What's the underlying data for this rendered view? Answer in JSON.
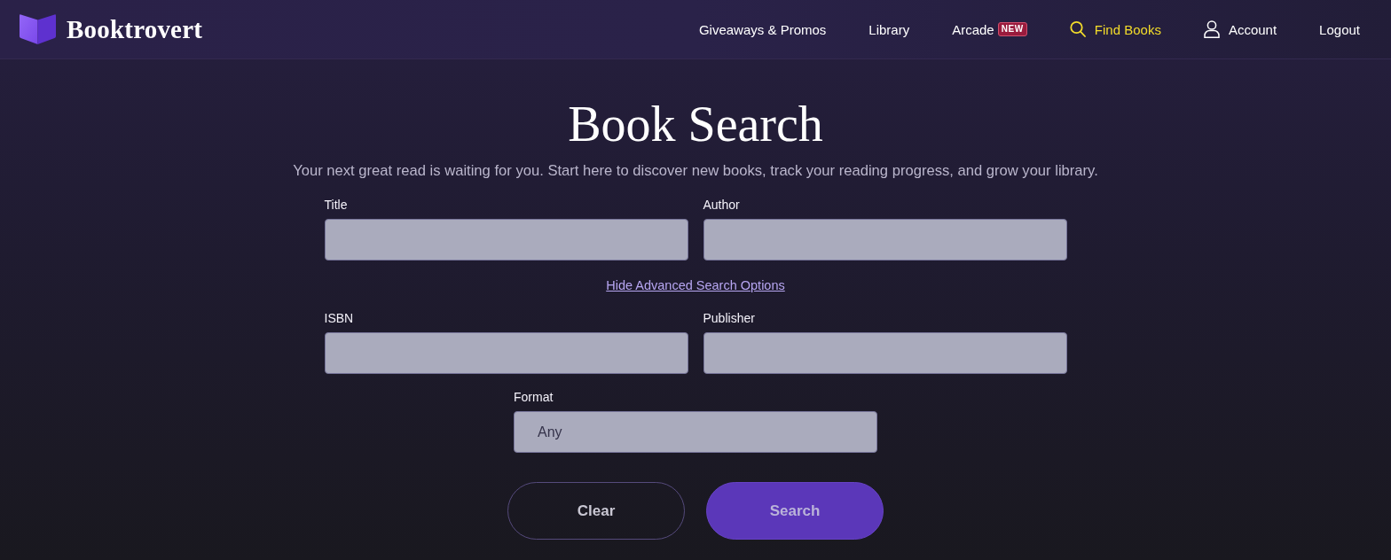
{
  "header": {
    "brand": "Booktrovert",
    "nav": [
      {
        "kind": "text",
        "label": "Giveaways & Promos",
        "selected": false
      },
      {
        "kind": "text",
        "label": "Library",
        "selected": false
      },
      {
        "kind": "text",
        "label": "Arcade",
        "badge": "NEW",
        "selected": false
      },
      {
        "kind": "search",
        "label": "Find Books",
        "selected": true
      },
      {
        "kind": "account",
        "label": "Account",
        "selected": false
      },
      {
        "kind": "text",
        "label": "Logout",
        "selected": false
      }
    ]
  },
  "page": {
    "title": "Book Search",
    "subtitle": "Your next great read is waiting for you. Start here to discover new books, track your reading progress, and grow your library."
  },
  "form": {
    "basic_fields": [
      {
        "label": "Title"
      },
      {
        "label": "Author"
      }
    ],
    "toggle_link": "Hide Advanced Search Options",
    "advanced_fields": [
      {
        "label": "ISBN"
      },
      {
        "label": "Publisher"
      }
    ],
    "format": {
      "label": "Format",
      "value": "Any"
    },
    "buttons": [
      {
        "kind": "secondary",
        "label": "Clear"
      },
      {
        "kind": "primary",
        "label": "Search"
      }
    ]
  }
}
